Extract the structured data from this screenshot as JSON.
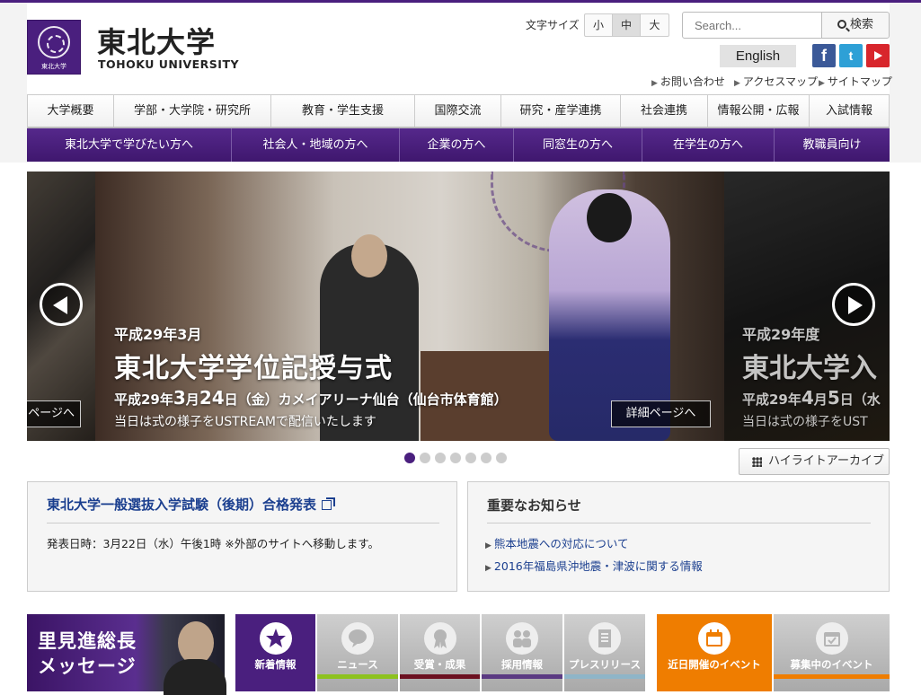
{
  "header": {
    "logo_jp": "東北大学",
    "logo_en": "TOHOKU UNIVERSITY",
    "logo_seal_text": "東北大学",
    "font_size_label": "文字サイズ",
    "font_sizes": [
      "小",
      "中",
      "大"
    ],
    "search_placeholder": "Search...",
    "search_button": "検索",
    "english": "English",
    "sns": [
      "f",
      "t",
      ""
    ],
    "util_links": [
      "お問い合わせ",
      "アクセスマップ",
      "サイトマップ"
    ]
  },
  "global_nav": [
    "大学概要",
    "学部・大学院・研究所",
    "教育・学生支援",
    "国際交流",
    "研究・産学連携",
    "社会連携",
    "情報公開・広報",
    "入試情報"
  ],
  "purpose_nav": [
    "東北大学で学びたい方へ",
    "社会人・地域の方へ",
    "企業の方へ",
    "同窓生の方へ",
    "在学生の方へ",
    "教職員向け"
  ],
  "hero": {
    "date": "平成29年3月",
    "title": "東北大学学位記授与式",
    "sub_pre": "平成29年",
    "sub_m": "3",
    "sub_mid": "月",
    "sub_d": "24",
    "sub_post": "日（金）カメイアリーナ仙台（仙台市体育館）",
    "desc": "当日は式の様子をUSTREAMで配信いたします",
    "detail": "詳細ページへ",
    "prev_detail": "ページへ",
    "next_date": "平成29年度",
    "next_title": "東北大学入",
    "next_sub_pre": "平成29年",
    "next_sub_m": "4",
    "next_sub_mid": "月",
    "next_sub_d": "5",
    "next_sub_post": "日（水",
    "next_desc": "当日は式の様子をUST",
    "slide_count": 7,
    "active_slide": 1
  },
  "archive_button": "ハイライトアーカイブ",
  "notice1": {
    "title": "東北大学一般選抜入学試験（後期）合格発表",
    "text": "発表日時：3月22日（水）午後1時 ※外部のサイトへ移動します。"
  },
  "notice2": {
    "title": "重要なお知らせ",
    "items": [
      "熊本地震への対応について",
      "2016年福島県沖地震・津波に関する情報"
    ]
  },
  "president": {
    "line1": "里見進総長",
    "line2": "メッセージ"
  },
  "tabs": [
    {
      "label": "新着情報",
      "icon": "star-icon",
      "color": "#4a1f7e"
    },
    {
      "label": "ニュース",
      "icon": "speech-bubble-icon",
      "color": "#8dc21f"
    },
    {
      "label": "受賞・成果",
      "icon": "medal-icon",
      "color": "#6b1020"
    },
    {
      "label": "採用情報",
      "icon": "people-icon",
      "color": "#5b3a82"
    },
    {
      "label": "プレスリリース",
      "icon": "document-icon",
      "color": "#8fb5c8"
    },
    {
      "label": "近日開催のイベント",
      "icon": "calendar-icon",
      "color": "#ef7d00"
    },
    {
      "label": "募集中のイベント",
      "icon": "calendar-check-icon",
      "color": "#ef7d00"
    }
  ],
  "colors": {
    "brand": "#4a1f7e",
    "link": "#1b3f8f",
    "orange": "#ef7d00"
  }
}
